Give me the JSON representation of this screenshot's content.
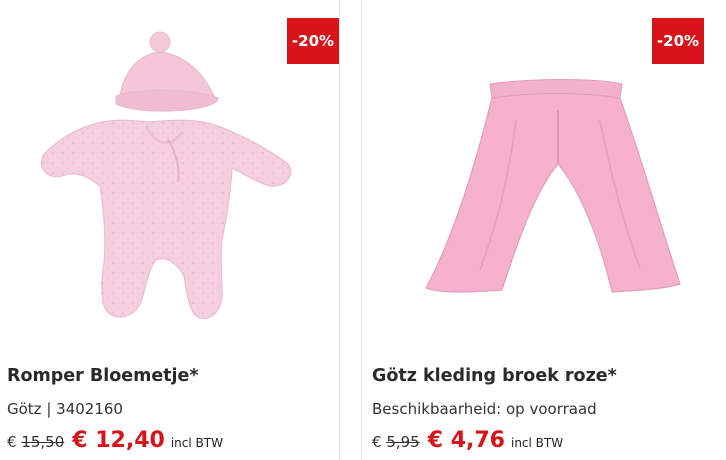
{
  "products": [
    {
      "badge": "-20%",
      "image_alt": "Romper Bloemetje",
      "title": "Romper Bloemetje*",
      "meta": "Götz | 3402160",
      "old_price_currency": "€",
      "old_price_amount": "15,50",
      "new_price": "€ 12,40",
      "incl": "incl BTW"
    },
    {
      "badge": "-20%",
      "image_alt": "Götz kleding broek roze",
      "title": "Götz kleding broek roze*",
      "meta": "Beschikbaarheid: op voorraad",
      "old_price_currency": "€",
      "old_price_amount": "5,95",
      "new_price": "€ 4,76",
      "incl": "incl BTW"
    }
  ],
  "colors": {
    "accent": "#d7141a",
    "garment_pink": "#f3c7d9",
    "pants_pink": "#f2a6c3"
  }
}
